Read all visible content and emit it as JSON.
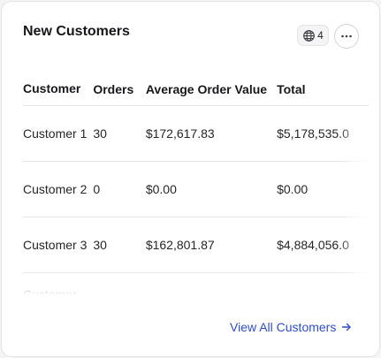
{
  "card": {
    "title": "New Customers",
    "badge_count": "4",
    "view_all_label": "View All Customers"
  },
  "table": {
    "headers": [
      "Customer",
      "Orders",
      "Average Order Value",
      "Total"
    ],
    "rows": [
      [
        "Customer 1",
        "30",
        "$172,617.83",
        "$5,178,535.0"
      ],
      [
        "Customer 2",
        "0",
        "$0.00",
        "$0.00"
      ],
      [
        "Customer 3",
        "30",
        "$162,801.87",
        "$4,884,056.0"
      ],
      [
        "Customer",
        "",
        "",
        ""
      ]
    ]
  },
  "colors": {
    "link": "#2f4ec8",
    "border": "#e4e4e7",
    "text": "#27272a"
  },
  "icons": [
    "globe-icon",
    "more-horizontal-icon",
    "arrow-right-icon"
  ]
}
